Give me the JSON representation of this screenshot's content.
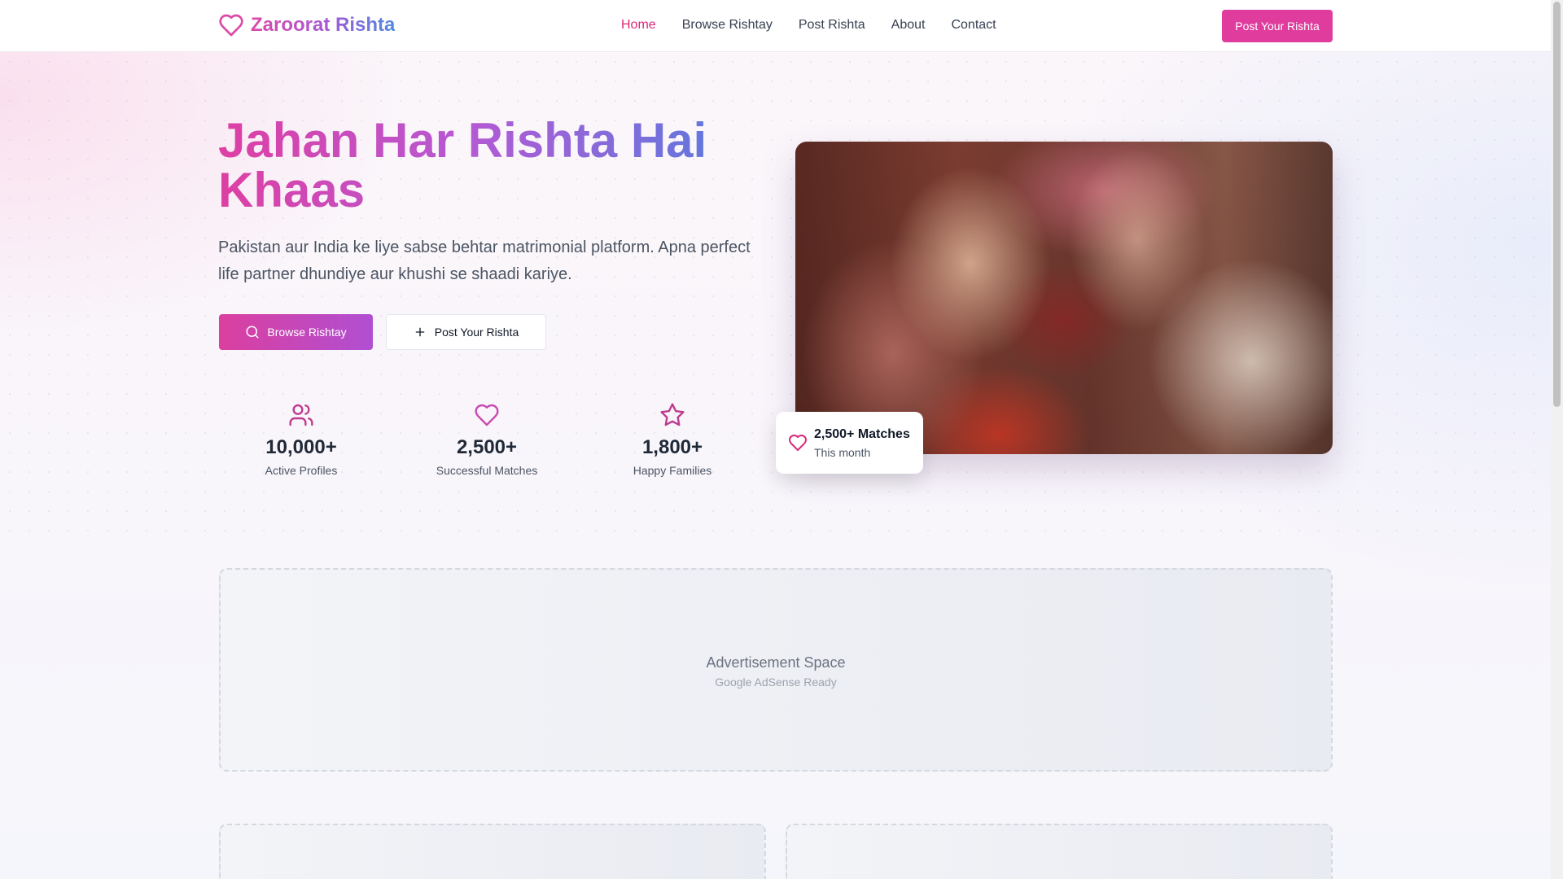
{
  "colors": {
    "brand": "#db2777",
    "accent": "#e03c9d",
    "gradient_end": "#4f7fe0"
  },
  "nav": {
    "brand_name": "Zaroorat Rishta",
    "brand_icon": "heart-icon",
    "links": [
      {
        "label": "Home",
        "active": true
      },
      {
        "label": "Browse Rishtay",
        "active": false
      },
      {
        "label": "Post Rishta",
        "active": false
      },
      {
        "label": "About",
        "active": false
      },
      {
        "label": "Contact",
        "active": false
      }
    ],
    "cta_label": "Post Your Rishta"
  },
  "hero": {
    "title": "Jahan Har Rishta Hai Khaas",
    "subtitle": "Pakistan aur India ke liye sabse behtar matrimonial platform. Apna perfect life partner dhundiye aur khushi se shaadi kariye.",
    "primary_button": {
      "label": "Browse Rishtay",
      "icon": "search-icon"
    },
    "secondary_button": {
      "label": "Post Your Rishta",
      "icon": "plus-icon"
    },
    "stats": [
      {
        "icon": "users-icon",
        "value": "10,000+",
        "label": "Active Profiles"
      },
      {
        "icon": "heart-icon",
        "value": "2,500+",
        "label": "Successful Matches"
      },
      {
        "icon": "star-icon",
        "value": "1,800+",
        "label": "Happy Families"
      }
    ],
    "match_card": {
      "icon": "heart-icon",
      "title": "2,500+ Matches",
      "subtitle": "This month"
    }
  },
  "ad": {
    "title": "Advertisement Space",
    "subtitle": "Google AdSense Ready"
  }
}
